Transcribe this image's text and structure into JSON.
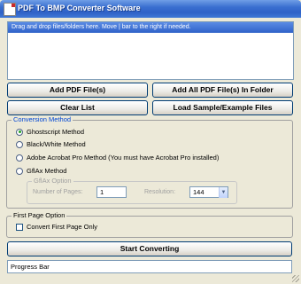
{
  "window": {
    "title": "PDF To BMP Converter Software",
    "icon": "pdf-app-icon"
  },
  "drop_area": {
    "hint": "Drag and drop files/folders here. Move | bar to the right if needed."
  },
  "buttons": {
    "add_files": "Add PDF File(s)",
    "add_all_in_folder": "Add All PDF File(s) In Folder",
    "clear_list": "Clear List",
    "load_sample": "Load Sample/Example Files",
    "start": "Start Converting"
  },
  "conversion_method": {
    "title": "Conversion Method",
    "options": [
      {
        "label": "Ghostscript Method",
        "selected": true
      },
      {
        "label": "Black/White Method",
        "selected": false
      },
      {
        "label": "Adobe Acrobat Pro Method (You must have Acrobat Pro installed)",
        "selected": false
      },
      {
        "label": "GflAx Method",
        "selected": false
      }
    ],
    "gflax_option": {
      "title": "GflAx Option",
      "pages_label": "Number of Pages:",
      "pages_value": "1",
      "resolution_label": "Resolution:",
      "resolution_value": "144"
    }
  },
  "first_page_option": {
    "title": "First Page Option",
    "checkbox_label": "Convert First Page Only",
    "checked": false
  },
  "progress": {
    "label": "Progress Bar"
  }
}
